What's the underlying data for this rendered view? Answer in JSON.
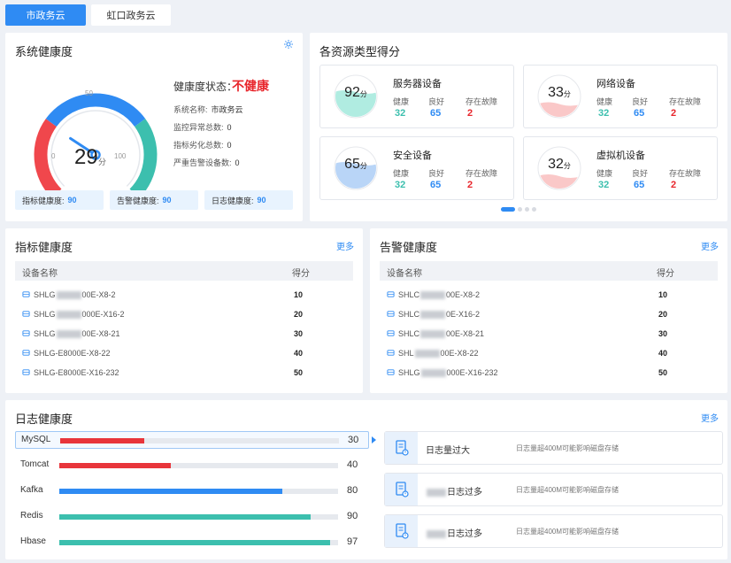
{
  "tabs": [
    {
      "label": "市政务云",
      "active": true
    },
    {
      "label": "虹口政务云",
      "active": false
    }
  ],
  "system_health": {
    "title": "系统健康度",
    "score": 29,
    "score_unit": "分",
    "gauge_ticks": {
      "min": "0",
      "mid": "50",
      "max": "100"
    },
    "status_label": "健康度状态：",
    "status_value": "不健康",
    "info": [
      {
        "label": "系统名称:",
        "value": "市政务云"
      },
      {
        "label": "监控异常总数:",
        "value": "0"
      },
      {
        "label": "指标劣化总数:",
        "value": "0"
      },
      {
        "label": "严重告警设备数:",
        "value": "0"
      }
    ],
    "pills": [
      {
        "label": "指标健康度:",
        "value": "90"
      },
      {
        "label": "告警健康度:",
        "value": "90"
      },
      {
        "label": "日志健康度:",
        "value": "90"
      }
    ]
  },
  "resource_scores": {
    "title": "各资源类型得分",
    "unit": "分",
    "sub_labels": [
      "健康",
      "良好",
      "存在故障"
    ],
    "items": [
      {
        "name": "服务器设备",
        "score": "92",
        "fill": 0.92,
        "wave": "#6fdcc8",
        "values": [
          "32",
          "65",
          "2"
        ]
      },
      {
        "name": "网络设备",
        "score": "33",
        "fill": 0.33,
        "wave": "#f59a9a",
        "values": [
          "32",
          "65",
          "2"
        ]
      },
      {
        "name": "安全设备",
        "score": "65",
        "fill": 0.65,
        "wave": "#7fb2f0",
        "values": [
          "32",
          "65",
          "2"
        ]
      },
      {
        "name": "虚拟机设备",
        "score": "32",
        "fill": 0.32,
        "wave": "#f59a9a",
        "values": [
          "32",
          "65",
          "2"
        ]
      }
    ]
  },
  "indicator_health": {
    "title": "指标健康度",
    "more": "更多",
    "headers": [
      "设备名称",
      "得分"
    ],
    "rows": [
      {
        "pre": "SHLG",
        "post": "00E-X8-2",
        "score": "10"
      },
      {
        "pre": "SHLG",
        "post": "000E-X16-2",
        "score": "20"
      },
      {
        "pre": "SHLG",
        "post": "00E-X8-21",
        "score": "30"
      },
      {
        "pre": "SHLG-E8000E-X8-22",
        "post": "",
        "score": "40"
      },
      {
        "pre": "SHLG-E8000E-X16-232",
        "post": "",
        "score": "50"
      }
    ]
  },
  "alarm_health": {
    "title": "告警健康度",
    "more": "更多",
    "headers": [
      "设备名称",
      "得分"
    ],
    "rows": [
      {
        "pre": "SHLC",
        "post": "00E-X8-2",
        "score": "10"
      },
      {
        "pre": "SHLC",
        "post": "0E-X16-2",
        "score": "20"
      },
      {
        "pre": "SHLC",
        "post": "00E-X8-21",
        "score": "30"
      },
      {
        "pre": "SHL",
        "post": "00E-X8-22",
        "score": "40"
      },
      {
        "pre": "SHLG",
        "post": "000E-X16-232",
        "score": "50"
      }
    ]
  },
  "log_health": {
    "title": "日志健康度",
    "more": "更多",
    "bars": [
      {
        "name": "MySQL",
        "value": 30,
        "color": "#e8353b",
        "selected": true
      },
      {
        "name": "Tomcat",
        "value": 40,
        "color": "#e8353b",
        "selected": false
      },
      {
        "name": "Kafka",
        "value": 80,
        "color": "#2f8bf3",
        "selected": false
      },
      {
        "name": "Redis",
        "value": 90,
        "color": "#3cbfae",
        "selected": false
      },
      {
        "name": "Hbase",
        "value": 97,
        "color": "#3cbfae",
        "selected": false
      }
    ],
    "alerts": [
      {
        "title": "日志量过大",
        "desc": "日志量超400M可能影响磁盘存储"
      },
      {
        "title": "日志过多",
        "desc": "日志量超400M可能影响磁盘存储",
        "redacted": true
      },
      {
        "title": "日志过多",
        "desc": "日志量超400M可能影响磁盘存储",
        "redacted": true
      }
    ]
  },
  "colors": {
    "accent": "#2f8bf3",
    "danger": "#e8262c",
    "good": "#3cbfae"
  }
}
